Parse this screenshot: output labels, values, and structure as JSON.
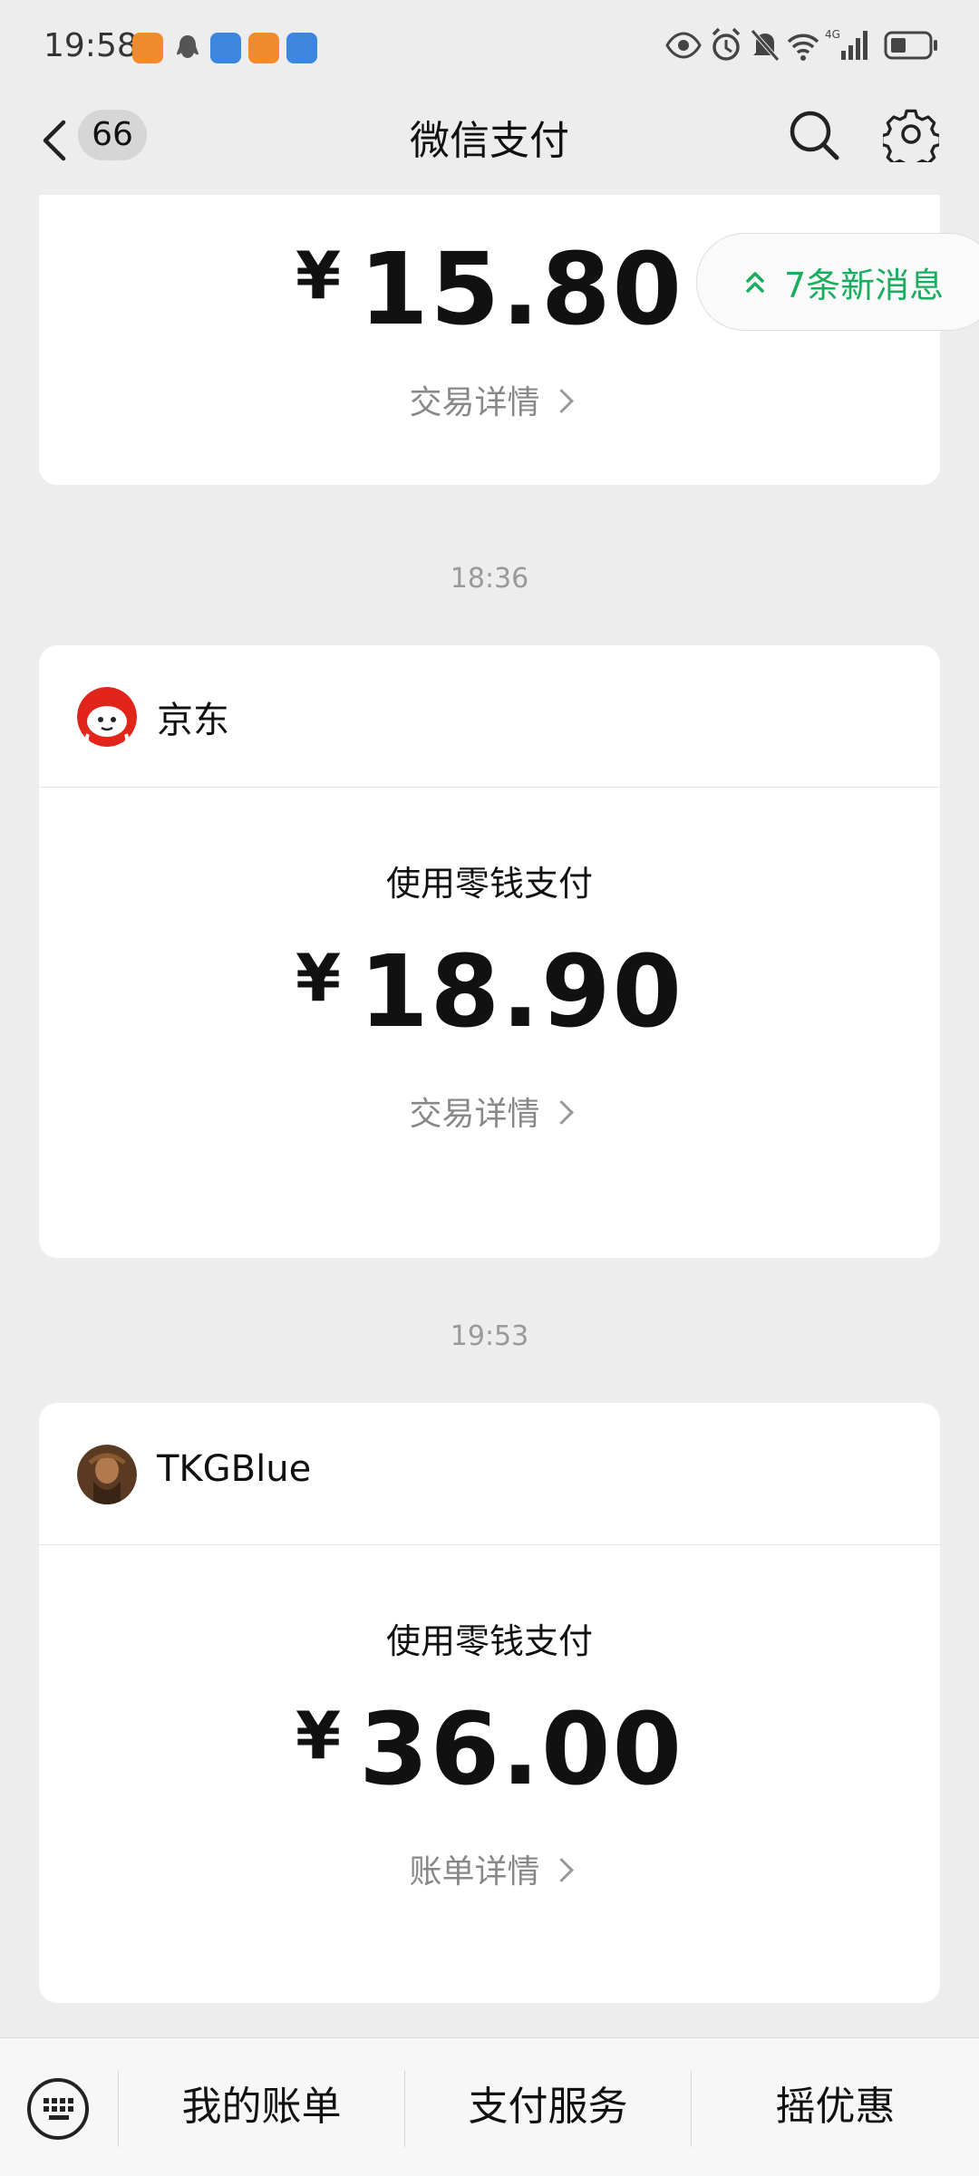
{
  "status_bar": {
    "time": "19:58"
  },
  "header": {
    "back_badge": "66",
    "title": "微信支付"
  },
  "new_messages": {
    "label": "7条新消息"
  },
  "cards": [
    {
      "amount_currency": "¥",
      "amount": "15.80",
      "detail_label": "交易详情"
    },
    {
      "timestamp": "18:36",
      "merchant": "京东",
      "pay_method": "使用零钱支付",
      "amount_currency": "¥",
      "amount": "18.90",
      "detail_label": "交易详情"
    },
    {
      "timestamp": "19:53",
      "merchant": "TKGBlue",
      "pay_method": "使用零钱支付",
      "amount_currency": "¥",
      "amount": "36.00",
      "detail_label": "账单详情"
    }
  ],
  "bottom_bar": {
    "tabs": [
      "我的账单",
      "支付服务",
      "摇优惠"
    ]
  },
  "colors": {
    "accent": "#1aad5f",
    "background": "#ededed"
  }
}
